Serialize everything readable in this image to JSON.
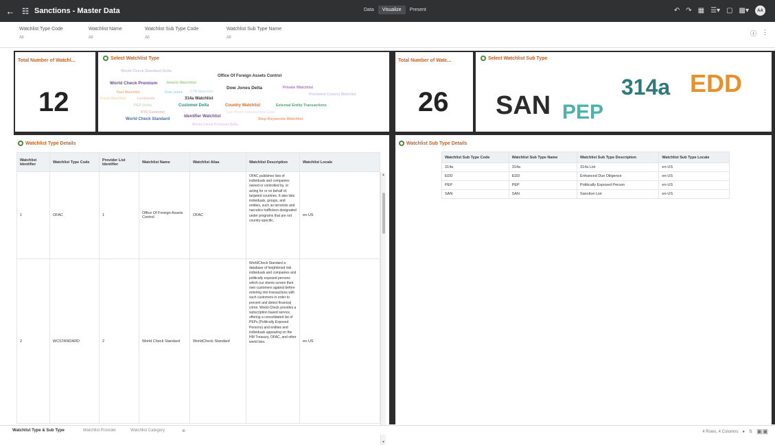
{
  "app": {
    "title": "Sanctions - Master Data"
  },
  "modes": [
    "Data",
    "Visualize",
    "Present"
  ],
  "active_mode": "Visualize",
  "filters": [
    {
      "label": "Watchlist Type Code",
      "value": "All"
    },
    {
      "label": "Watchlist Name",
      "value": "All"
    },
    {
      "label": "Watchlist Sub Type Code",
      "value": "All"
    },
    {
      "label": "Watchlist Sub Type Name",
      "value": "All"
    }
  ],
  "tiles": {
    "total_watchlist": {
      "title": "Total Number of Watchl...",
      "value": "12"
    },
    "select_type": {
      "title": "Select Watchlist Type"
    },
    "total_sub": {
      "title": "Total Number of Watc...",
      "value": "26"
    },
    "select_sub_type": {
      "title": "Select Watchlist Sub Type"
    }
  },
  "type_cloud": [
    {
      "text": "World Check Standard Delta",
      "color": "#c9c7ea"
    },
    {
      "text": "Office Of Foreign Assets Control",
      "color": "#333333"
    },
    {
      "text": "World Check Premium",
      "color": "#6a4a8a"
    },
    {
      "text": "Jewels Watchlist",
      "color": "#9ccc8c"
    },
    {
      "text": "Dow Jones Delta",
      "color": "#333333"
    },
    {
      "text": "Private Watchlist",
      "color": "#a879c4"
    },
    {
      "text": "Fast Watchlist",
      "color": "#f0b38a"
    },
    {
      "text": "Dow Jones",
      "color": "#a6d8ea"
    },
    {
      "text": "CTR Watchlist",
      "color": "#c8e0f0"
    },
    {
      "text": "Prohibited Country Watchlist",
      "color": "#c9c7ea"
    },
    {
      "text": "Fraud Watchlist",
      "color": "#f8d8a8"
    },
    {
      "text": "Lexisnexis",
      "color": "#f0c0c0"
    },
    {
      "text": "314a Watchlist",
      "color": "#333333"
    },
    {
      "text": "PEP Delta",
      "color": "#c8e0c0"
    },
    {
      "text": "Customer Delta",
      "color": "#2e8b7e"
    },
    {
      "text": "Country Watchlist",
      "color": "#d46a2a"
    },
    {
      "text": "External Entity Transactions",
      "color": "#4aa36a"
    },
    {
      "text": "KYC Customer",
      "color": "#f2b6b6"
    },
    {
      "text": "Sub Watch Transactions Data",
      "color": "#e8e0f0"
    },
    {
      "text": "World Check Standard",
      "color": "#4a6aa8"
    },
    {
      "text": "Identifier Watchlist",
      "color": "#6a4a8a"
    },
    {
      "text": "Stop Keywords Watchlist",
      "color": "#f0a070"
    },
    {
      "text": "World Check Premium Delta",
      "color": "#e8c8e8"
    }
  ],
  "sub_cloud": [
    {
      "text": "SAN",
      "color": "#2b2b2b"
    },
    {
      "text": "PEP",
      "color": "#4ab3b0"
    },
    {
      "text": "314a",
      "color": "#2e7a7a"
    },
    {
      "text": "EDD",
      "color": "#e8902a"
    }
  ],
  "watchlist_details": {
    "title": "Watchlist Type Details",
    "columns": [
      "Watchlist Identifier",
      "Watchlist Type Code",
      "Provider List Identifier",
      "Watchlist Name",
      "Watchlist Alias",
      "Watchlist Description",
      "Watchlist Locale"
    ],
    "rows": [
      [
        "1",
        "OFAC",
        "1",
        "Office Of Foreign Assets Control",
        "OFAC",
        "OFAC publishes lists of individuals and companies owned or controlled by, or acting for or on behalf of, targeted countries. It also lists individuals, groups, and entities, such as terrorists and narcotics traffickers designated under programs that are not country-specific.",
        "en-US"
      ],
      [
        "2",
        "WCSTANDARD",
        "2",
        "World Check Standard",
        "WorldCheck Standard",
        "WorldCheck Standard a database of heightened risk individuals and companies and politically exposed persons which our clients screen their own customers against before entering into transactions with such customers in order to prevent and detect financial crime. World-Check provides a subscription based service, offering a consolidated list of PEPs (Politically Exposed Persons) and entities and individuals appearing on the HM Treasury, OFAC, and other world lists.",
        "en-US"
      ]
    ]
  },
  "subtype_details": {
    "title": "Watchlist Sub Type Details",
    "columns": [
      "Watchlist Sub Type Code",
      "Watchlist Sub Type Name",
      "Watchlist Sub Type Description",
      "Watchlist Sub Type Locale"
    ],
    "rows": [
      [
        "314a",
        "314a",
        "314a List",
        "en-US"
      ],
      [
        "EDD",
        "EDD",
        "Enhanced Due Diligence",
        "en-US"
      ],
      [
        "PEP",
        "PEP",
        "Politically Exposed Person",
        "en-US"
      ],
      [
        "SAN",
        "SAN",
        "Sanction List",
        "en-US"
      ]
    ]
  },
  "bottom_tabs": [
    "Watchlist Type & Sub Type",
    "Watchlist Provider",
    "Watchlist Category"
  ],
  "status": {
    "rows_cols": "4 Rows, 4 Columns"
  }
}
